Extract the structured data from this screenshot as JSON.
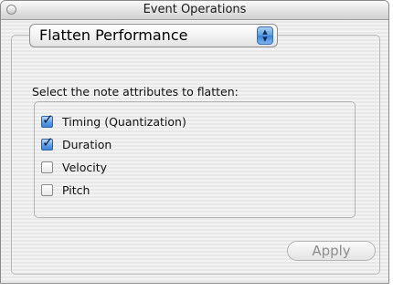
{
  "window": {
    "title": "Event Operations",
    "close_icon": "close-circle-icon"
  },
  "operation_popup": {
    "selected": "Flatten Performance",
    "arrows_icon": "popup-up-down-arrows-icon",
    "arrow_up": "▲",
    "arrow_down": "▼"
  },
  "attributes": {
    "section_label": "Select the note attributes to flatten:",
    "check_glyph": "✓",
    "items": [
      {
        "label": "Timing (Quantization)",
        "checked": true
      },
      {
        "label": "Duration",
        "checked": true
      },
      {
        "label": "Velocity",
        "checked": false
      },
      {
        "label": "Pitch",
        "checked": false
      }
    ]
  },
  "apply_button": {
    "label": "Apply",
    "enabled": false
  },
  "colors": {
    "aqua_blue": "#3e82d8",
    "disabled_text": "#8c8c8c"
  }
}
